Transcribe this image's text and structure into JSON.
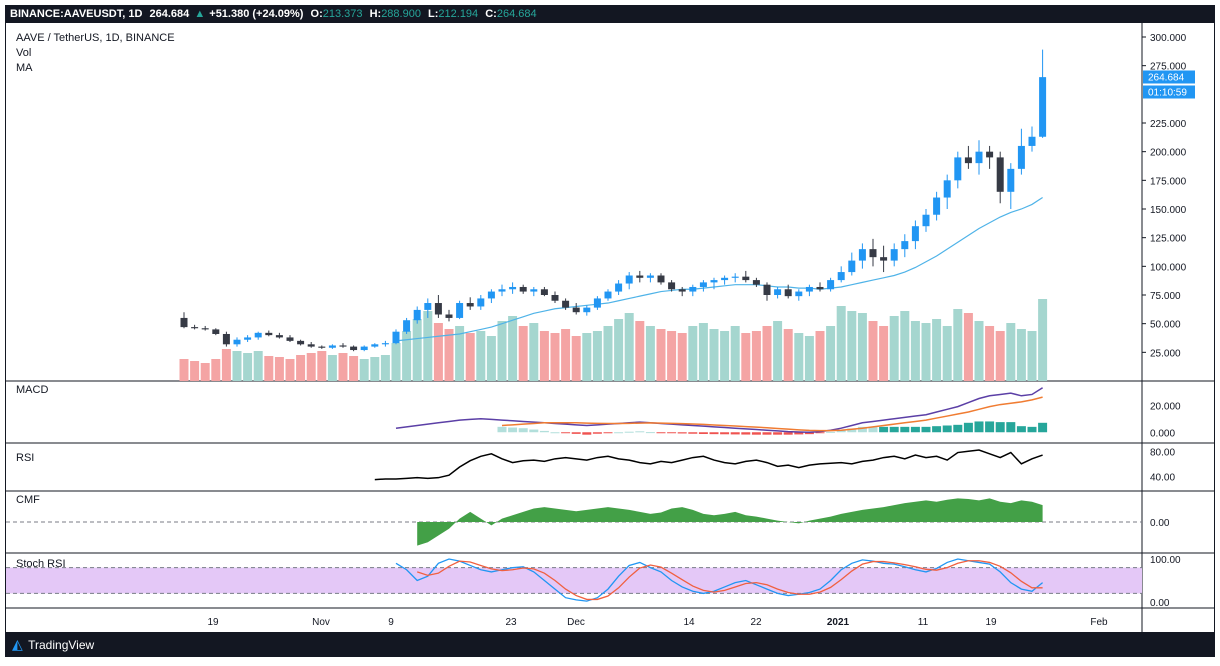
{
  "header": {
    "symbol": "BINANCE:AAVEUSDT, 1D",
    "last": "264.684",
    "change": "+51.380 (+24.09%)",
    "o_label": "O:",
    "o": "213.373",
    "h_label": "H:",
    "h": "288.900",
    "l_label": "L:",
    "l": "212.194",
    "c_label": "C:",
    "c": "264.684"
  },
  "legend": {
    "title": "AAVE / TetherUS, 1D, BINANCE",
    "vol": "Vol",
    "ma": "MA",
    "macd": "MACD",
    "rsi": "RSI",
    "cmf": "CMF",
    "stoch": "Stoch RSI"
  },
  "price_badge": "264.684",
  "timer_badge": "01:10:59",
  "footer": {
    "brand": "TradingView"
  },
  "colors": {
    "up": "#2196f3",
    "down": "#363a45",
    "vol_up": "#a5d6cf",
    "vol_down": "#f4a4a4",
    "ma": "#4fb3e8",
    "macd": "#5b3fa6",
    "signal": "#f07c32",
    "rsi": "#000000",
    "cmf": "#43a047",
    "stoch_k": "#2196f3",
    "stoch_d": "#f06040",
    "stoch_band": "#e4c8f7"
  },
  "chart_data": {
    "type": "candlestick",
    "x_ticks": [
      "19",
      "Nov",
      "9",
      "23",
      "Dec",
      "14",
      "22",
      "2021",
      "11",
      "19",
      "Feb"
    ],
    "price_axis": {
      "ticks": [
        "300.000",
        "275.000",
        "225.000",
        "200.000",
        "175.000",
        "150.000",
        "125.000",
        "100.000",
        "75.000",
        "50.000",
        "25.000"
      ],
      "ylim": [
        0,
        300
      ]
    },
    "macd_axis": {
      "ticks": [
        "20.000",
        "0.000"
      ]
    },
    "rsi_axis": {
      "ticks": [
        "80.00",
        "40.00"
      ]
    },
    "cmf_axis": {
      "ticks": [
        "0.00"
      ]
    },
    "stoch_axis": {
      "ticks": [
        "100.00",
        "0.00"
      ]
    },
    "candles": [
      [
        55,
        60,
        46,
        47
      ],
      [
        47,
        49,
        45,
        46
      ],
      [
        46,
        48,
        44,
        45
      ],
      [
        45,
        46,
        40,
        41
      ],
      [
        41,
        43,
        30,
        32
      ],
      [
        32,
        38,
        30,
        36
      ],
      [
        36,
        40,
        34,
        38
      ],
      [
        38,
        43,
        36,
        42
      ],
      [
        42,
        44,
        39,
        40
      ],
      [
        40,
        42,
        37,
        38
      ],
      [
        38,
        40,
        34,
        35
      ],
      [
        35,
        36,
        31,
        32
      ],
      [
        32,
        34,
        29,
        30
      ],
      [
        30,
        31,
        28,
        29
      ],
      [
        29,
        32,
        28,
        31
      ],
      [
        31,
        33,
        29,
        30
      ],
      [
        30,
        31,
        26,
        27
      ],
      [
        27,
        31,
        26,
        30
      ],
      [
        30,
        33,
        29,
        32
      ],
      [
        32,
        35,
        30,
        33
      ],
      [
        33,
        45,
        32,
        43
      ],
      [
        43,
        55,
        41,
        53
      ],
      [
        53,
        65,
        50,
        62
      ],
      [
        62,
        72,
        55,
        68
      ],
      [
        68,
        75,
        55,
        58
      ],
      [
        58,
        62,
        52,
        55
      ],
      [
        55,
        70,
        54,
        68
      ],
      [
        68,
        73,
        62,
        65
      ],
      [
        65,
        75,
        62,
        72
      ],
      [
        72,
        80,
        68,
        78
      ],
      [
        78,
        84,
        74,
        80
      ],
      [
        80,
        86,
        76,
        82
      ],
      [
        82,
        84,
        76,
        78
      ],
      [
        78,
        82,
        74,
        80
      ],
      [
        80,
        82,
        74,
        75
      ],
      [
        75,
        78,
        68,
        70
      ],
      [
        70,
        72,
        62,
        64
      ],
      [
        64,
        68,
        58,
        60
      ],
      [
        60,
        66,
        57,
        64
      ],
      [
        64,
        74,
        62,
        72
      ],
      [
        72,
        80,
        70,
        78
      ],
      [
        78,
        88,
        75,
        85
      ],
      [
        85,
        95,
        80,
        92
      ],
      [
        92,
        96,
        86,
        90
      ],
      [
        90,
        94,
        86,
        92
      ],
      [
        92,
        94,
        84,
        86
      ],
      [
        86,
        88,
        78,
        80
      ],
      [
        80,
        82,
        74,
        78
      ],
      [
        78,
        84,
        74,
        82
      ],
      [
        82,
        88,
        78,
        86
      ],
      [
        86,
        90,
        80,
        88
      ],
      [
        88,
        92,
        84,
        90
      ],
      [
        90,
        94,
        86,
        91
      ],
      [
        91,
        96,
        86,
        88
      ],
      [
        88,
        90,
        82,
        84
      ],
      [
        84,
        86,
        70,
        75
      ],
      [
        75,
        82,
        72,
        80
      ],
      [
        80,
        84,
        72,
        74
      ],
      [
        74,
        80,
        70,
        78
      ],
      [
        78,
        84,
        74,
        82
      ],
      [
        82,
        86,
        78,
        80
      ],
      [
        80,
        90,
        78,
        88
      ],
      [
        88,
        100,
        86,
        95
      ],
      [
        95,
        112,
        92,
        105
      ],
      [
        105,
        120,
        98,
        115
      ],
      [
        115,
        124,
        100,
        108
      ],
      [
        108,
        118,
        95,
        105
      ],
      [
        105,
        120,
        100,
        115
      ],
      [
        115,
        128,
        108,
        122
      ],
      [
        122,
        140,
        115,
        135
      ],
      [
        135,
        150,
        130,
        145
      ],
      [
        145,
        165,
        140,
        160
      ],
      [
        160,
        180,
        150,
        175
      ],
      [
        175,
        200,
        168,
        195
      ],
      [
        195,
        205,
        185,
        190
      ],
      [
        190,
        210,
        180,
        200
      ],
      [
        200,
        205,
        185,
        195
      ],
      [
        195,
        200,
        155,
        165
      ],
      [
        165,
        190,
        150,
        185
      ],
      [
        185,
        220,
        180,
        205
      ],
      [
        205,
        222,
        200,
        213
      ],
      [
        213,
        289,
        212,
        265
      ]
    ],
    "volume": [
      22,
      20,
      18,
      22,
      32,
      30,
      28,
      30,
      25,
      24,
      22,
      26,
      28,
      30,
      26,
      28,
      25,
      22,
      24,
      26,
      38,
      50,
      62,
      70,
      58,
      52,
      55,
      48,
      50,
      45,
      60,
      65,
      55,
      58,
      50,
      48,
      52,
      45,
      48,
      50,
      55,
      62,
      68,
      60,
      55,
      52,
      50,
      48,
      55,
      58,
      52,
      50,
      55,
      48,
      50,
      55,
      60,
      52,
      48,
      45,
      50,
      55,
      75,
      70,
      68,
      60,
      55,
      65,
      70,
      60,
      58,
      62,
      55,
      72,
      68,
      60,
      55,
      50,
      58,
      52,
      50,
      82
    ],
    "ma": [
      null,
      null,
      null,
      null,
      null,
      null,
      null,
      null,
      null,
      null,
      null,
      null,
      null,
      null,
      null,
      null,
      null,
      null,
      null,
      null,
      35,
      36,
      37,
      38,
      39,
      40,
      41,
      43,
      45,
      47,
      50,
      53,
      56,
      59,
      61,
      63,
      64,
      65,
      66,
      67,
      68,
      70,
      72,
      74,
      76,
      78,
      79,
      80,
      80,
      81,
      82,
      83,
      84,
      84,
      84,
      83,
      82,
      82,
      81,
      81,
      80,
      81,
      82,
      84,
      86,
      88,
      90,
      92,
      95,
      99,
      104,
      109,
      115,
      121,
      127,
      133,
      138,
      143,
      147,
      150,
      154,
      160
    ],
    "macd": [
      null,
      null,
      null,
      null,
      null,
      null,
      null,
      null,
      null,
      null,
      null,
      null,
      null,
      null,
      null,
      null,
      null,
      null,
      null,
      null,
      3,
      4,
      5,
      6,
      7,
      8,
      9,
      9.5,
      10,
      9.5,
      9,
      8.5,
      8,
      7.5,
      7,
      6.5,
      6,
      5.5,
      5,
      5.5,
      6,
      6.5,
      7,
      7.5,
      7,
      6.5,
      6,
      5.5,
      5,
      4.5,
      4,
      3.5,
      3,
      2.5,
      2,
      1.5,
      1,
      0.5,
      0.2,
      0,
      0.5,
      1.5,
      3,
      5,
      7,
      8,
      9,
      10,
      11,
      12,
      13,
      15,
      17,
      19,
      22,
      25,
      27,
      28,
      29,
      27,
      28,
      33
    ],
    "signal": [
      null,
      null,
      null,
      null,
      null,
      null,
      null,
      null,
      null,
      null,
      null,
      null,
      null,
      null,
      null,
      null,
      null,
      null,
      null,
      null,
      null,
      null,
      null,
      null,
      null,
      null,
      null,
      null,
      null,
      null,
      5,
      5.5,
      6,
      6.5,
      7,
      7,
      7,
      7,
      6.8,
      6.6,
      6.5,
      6.5,
      6.6,
      6.8,
      6.9,
      6.8,
      6.6,
      6.4,
      6.1,
      5.8,
      5.4,
      5,
      4.6,
      4.2,
      3.8,
      3.3,
      2.8,
      2.3,
      1.8,
      1.4,
      1.2,
      1.2,
      1.5,
      2.2,
      3,
      4,
      5,
      6,
      7,
      8,
      9,
      10.5,
      12,
      13.5,
      15,
      17,
      19,
      20.5,
      21.5,
      22.5,
      24,
      26
    ],
    "hist": [
      null,
      null,
      null,
      null,
      null,
      null,
      null,
      null,
      null,
      null,
      null,
      null,
      null,
      null,
      null,
      null,
      null,
      null,
      null,
      null,
      null,
      null,
      null,
      null,
      null,
      null,
      null,
      null,
      null,
      null,
      4,
      3.5,
      3,
      2,
      1,
      0,
      -0.5,
      -1.2,
      -1.8,
      -1.1,
      -0.5,
      0,
      0.4,
      0.7,
      0.1,
      -0.3,
      -0.6,
      -0.9,
      -1.1,
      -1.3,
      -1.4,
      -1.5,
      -1.6,
      -1.7,
      -1.8,
      -1.8,
      -1.8,
      -1.8,
      -1.6,
      -1.4,
      -0.7,
      0.3,
      1.5,
      2.8,
      4,
      4,
      4,
      4,
      4,
      4,
      4,
      4.5,
      5,
      5.5,
      7,
      8,
      8,
      7.5,
      7.5,
      4.5,
      4,
      7
    ],
    "rsi": [
      null,
      null,
      null,
      null,
      null,
      null,
      null,
      null,
      null,
      null,
      null,
      null,
      null,
      null,
      null,
      null,
      null,
      null,
      35,
      36,
      36,
      37,
      38,
      37,
      38,
      42,
      55,
      65,
      72,
      76,
      68,
      62,
      65,
      66,
      64,
      68,
      70,
      68,
      66,
      70,
      72,
      68,
      66,
      62,
      60,
      64,
      62,
      66,
      70,
      72,
      66,
      62,
      60,
      64,
      66,
      62,
      56,
      58,
      54,
      58,
      60,
      61,
      62,
      60,
      64,
      66,
      70,
      72,
      68,
      74,
      70,
      72,
      66,
      78,
      80,
      82,
      76,
      70,
      78,
      60,
      68,
      74
    ],
    "cmf": [
      null,
      null,
      null,
      null,
      null,
      null,
      null,
      null,
      null,
      null,
      null,
      null,
      null,
      null,
      null,
      null,
      null,
      null,
      null,
      null,
      null,
      null,
      -0.35,
      -0.3,
      -0.2,
      -0.1,
      0.05,
      0.15,
      0.05,
      -0.05,
      0.05,
      0.1,
      0.15,
      0.2,
      0.22,
      0.2,
      0.18,
      0.16,
      0.18,
      0.2,
      0.22,
      0.2,
      0.18,
      0.15,
      0.12,
      0.14,
      0.2,
      0.22,
      0.18,
      0.12,
      0.1,
      0.12,
      0.15,
      0.1,
      0.08,
      0.05,
      0.02,
      0,
      -0.02,
      0.02,
      0.05,
      0.08,
      0.12,
      0.15,
      0.18,
      0.2,
      0.22,
      0.25,
      0.28,
      0.3,
      0.32,
      0.3,
      0.33,
      0.35,
      0.34,
      0.32,
      0.35,
      0.3,
      0.28,
      0.32,
      0.3,
      0.25
    ],
    "stoch_k": [
      null,
      null,
      null,
      null,
      null,
      null,
      null,
      null,
      null,
      null,
      null,
      null,
      null,
      null,
      null,
      null,
      null,
      null,
      null,
      null,
      90,
      75,
      50,
      60,
      90,
      100,
      95,
      85,
      75,
      70,
      75,
      80,
      82,
      70,
      50,
      30,
      10,
      5,
      2,
      10,
      30,
      60,
      85,
      92,
      80,
      70,
      50,
      35,
      25,
      20,
      25,
      35,
      45,
      50,
      40,
      30,
      20,
      15,
      18,
      22,
      30,
      50,
      75,
      90,
      98,
      95,
      90,
      88,
      82,
      75,
      70,
      78,
      92,
      100,
      96,
      92,
      88,
      70,
      45,
      30,
      25,
      45
    ],
    "stoch_d": [
      null,
      null,
      null,
      null,
      null,
      null,
      null,
      null,
      null,
      null,
      null,
      null,
      null,
      null,
      null,
      null,
      null,
      null,
      null,
      null,
      null,
      null,
      70,
      62,
      67,
      83,
      95,
      93,
      85,
      77,
      73,
      75,
      79,
      77,
      67,
      50,
      30,
      15,
      6,
      6,
      14,
      33,
      58,
      79,
      86,
      81,
      67,
      52,
      37,
      27,
      23,
      27,
      35,
      43,
      45,
      40,
      30,
      22,
      18,
      18,
      23,
      34,
      52,
      72,
      88,
      94,
      94,
      91,
      87,
      82,
      76,
      74,
      80,
      90,
      96,
      96,
      92,
      83,
      68,
      48,
      33,
      33
    ]
  }
}
